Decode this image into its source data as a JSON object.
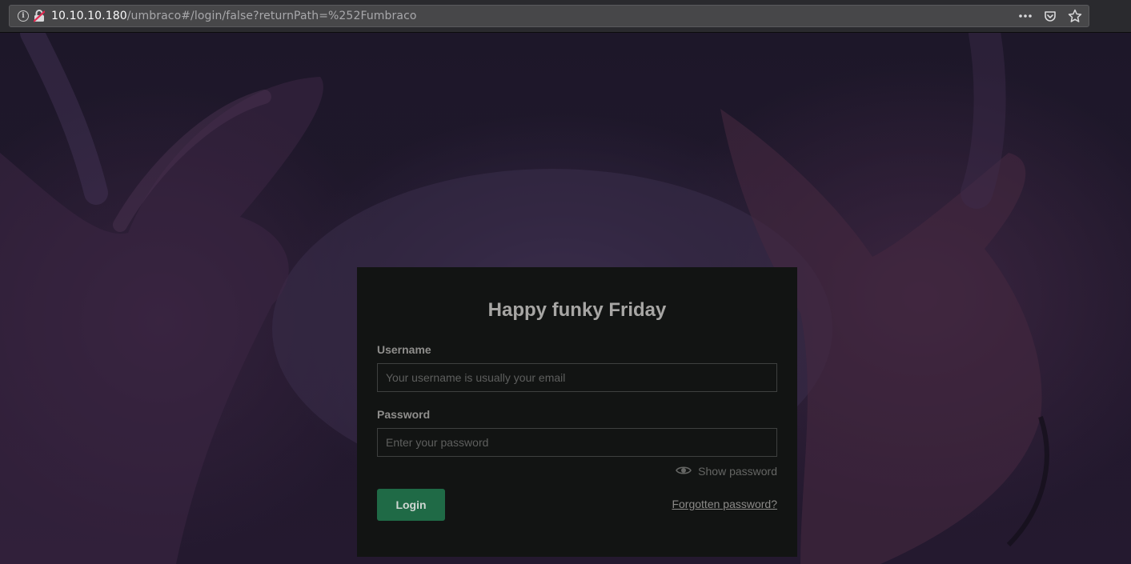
{
  "browser": {
    "url_host": "10.10.10.180",
    "url_path": "/umbraco#/login/false?returnPath=%252Fumbraco",
    "icons": [
      "info-icon",
      "insecure-lock-icon",
      "more-actions-icon",
      "pocket-icon",
      "bookmark-star-icon"
    ]
  },
  "login": {
    "greeting": "Happy funky Friday",
    "username_label": "Username",
    "username_placeholder": "Your username is usually your email",
    "username_value": "",
    "password_label": "Password",
    "password_placeholder": "Enter your password",
    "password_value": "",
    "show_password_label": "Show password",
    "login_button_label": "Login",
    "forgot_password_label": "Forgotten password?"
  },
  "colors": {
    "panel_background": "#121413",
    "login_button": "#1f6a46",
    "page_background": "#1c1526"
  }
}
